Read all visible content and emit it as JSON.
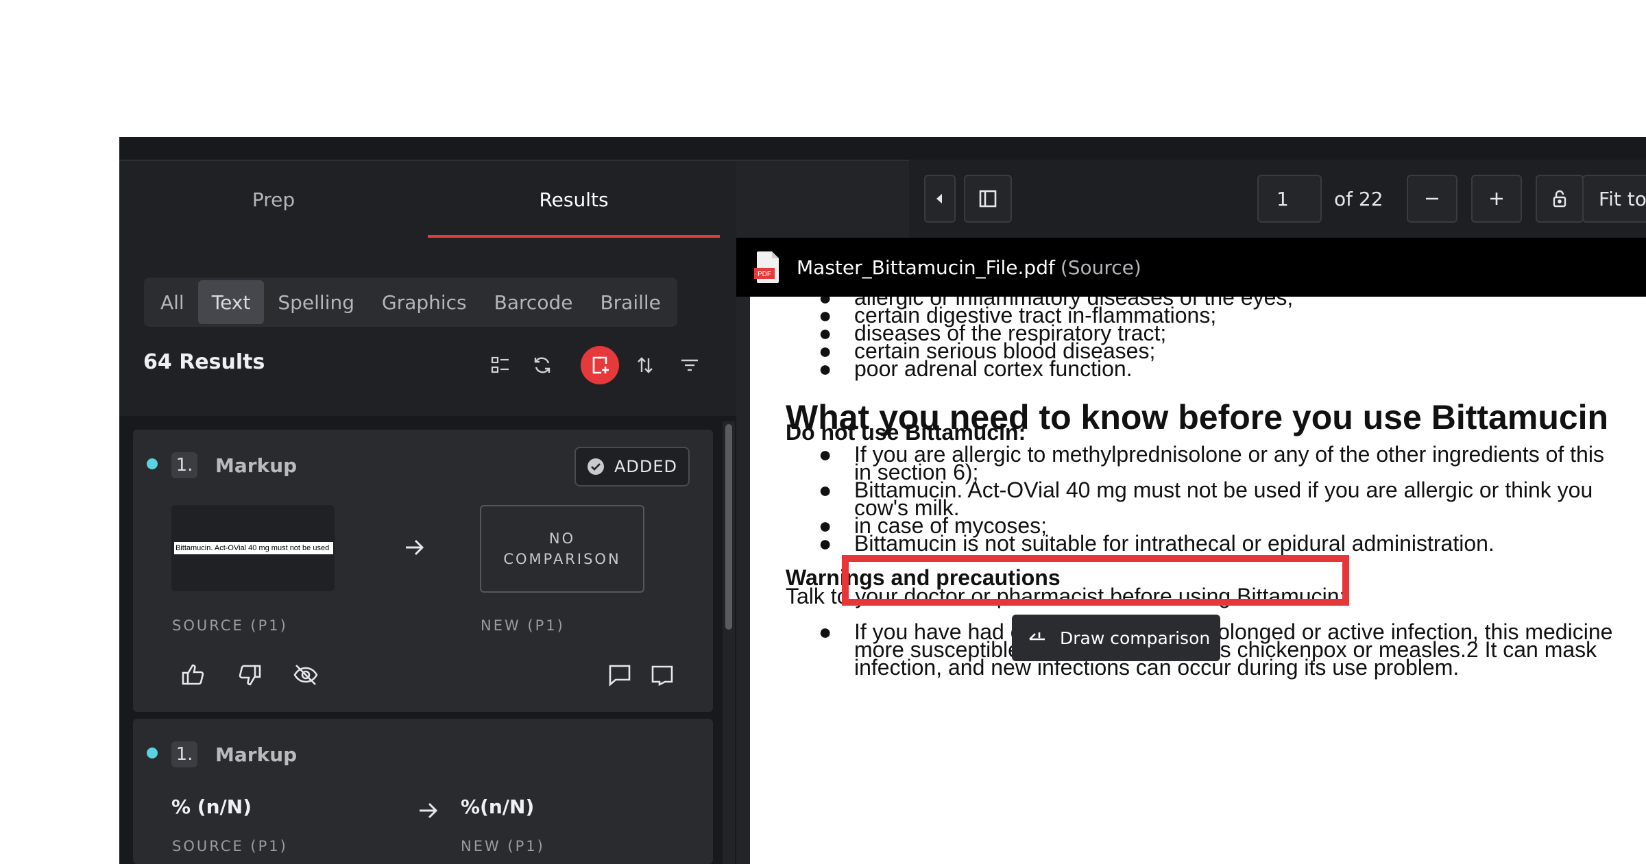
{
  "tabs": {
    "prep": "Prep",
    "results": "Results"
  },
  "filters": [
    "All",
    "Text",
    "Spelling",
    "Graphics",
    "Barcode",
    "Braille"
  ],
  "results_count": "64 Results",
  "cards": [
    {
      "number": "1.",
      "type": "Markup",
      "added_label": "ADDED",
      "source_thumb_text": "Bittamucin. Act-OVial 40 mg must not be used",
      "no_comparison_line1": "NO",
      "no_comparison_line2": "COMPARISON",
      "source_label": "SOURCE (P1)",
      "new_label": "NEW (P1)"
    },
    {
      "number": "1.",
      "type": "Markup",
      "source_value": "% (n/N)",
      "new_value": "%(n/N)",
      "source_label": "SOURCE (P1)",
      "new_label": "NEW (P1)"
    }
  ],
  "viewer": {
    "page_value": "1",
    "page_of": "of 22",
    "zoom_label": "Fit to width",
    "file_name": "Master_Bittamucin_File.pdf",
    "file_tag": "(Source)",
    "pdf_badge": "PDF"
  },
  "document": {
    "bullets_top": [
      "allergic or inflammatory diseases of the eyes;",
      "certain digestive tract in-flammations;",
      "diseases of the respiratory tract;",
      "certain serious blood diseases;",
      "poor adrenal cortex function."
    ],
    "heading": "What you need to know before you use Bittamucin",
    "subheading": "Do not use Bittamucin:",
    "b1_line1": "If you are allergic to methylprednisolone or any of the other ingredients of this",
    "b1_line2": "in section 6);",
    "b2_line1": "Bittamucin. Act-OVial 40 mg must not be used if you are allergic or think you",
    "b2_line2": "cow's milk.",
    "b3": "in case of mycoses;",
    "b4": "Bittamucin is not suitable for intrathecal or epidural administration.",
    "warnings_heading": "Warnings and precautions",
    "warnings_text": "Talk to your doctor or pharmacist before using Bittamucin:",
    "b5_line1": "If you have had or currently have a prolonged or active infection, this medicine",
    "b5_line2": "more susceptible to infections, such as chickenpox or measles.2 It can mask",
    "b5_line3": "infection, and new infections can occur during its use problem."
  },
  "tooltip": {
    "label": "Draw comparison"
  },
  "colors": {
    "accent_red": "#e5393b",
    "status_dot": "#5ad2e1"
  }
}
